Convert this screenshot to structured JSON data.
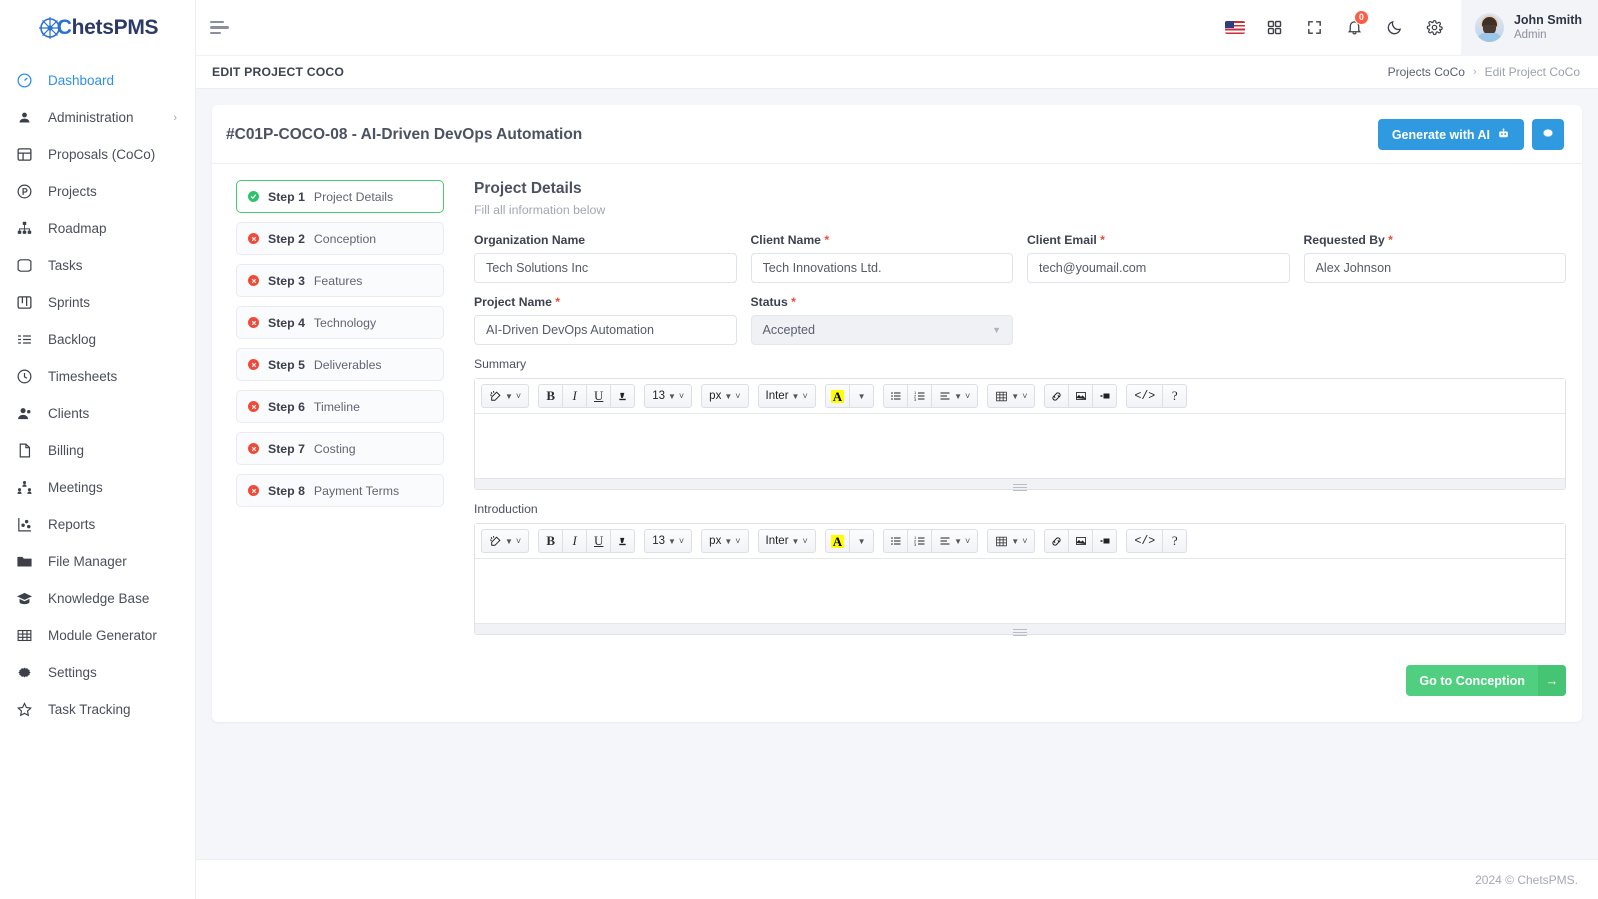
{
  "brand": {
    "name_c": "C",
    "name_rest": "hetsPMS"
  },
  "sidebar": {
    "items": [
      {
        "label": "Dashboard",
        "icon": "gauge-icon",
        "active": false,
        "chevron": false
      },
      {
        "label": "Administration",
        "icon": "user-circle-icon",
        "active": false,
        "chevron": true
      },
      {
        "label": "Proposals (CoCo)",
        "icon": "layout-icon",
        "active": true,
        "chevron": false
      },
      {
        "label": "Projects",
        "icon": "p-circle-icon",
        "active": false,
        "chevron": false
      },
      {
        "label": "Roadmap",
        "icon": "hierarchy-icon",
        "active": false,
        "chevron": false
      },
      {
        "label": "Tasks",
        "icon": "task-icon",
        "active": false,
        "chevron": false
      },
      {
        "label": "Sprints",
        "icon": "board-icon",
        "active": false,
        "chevron": false
      },
      {
        "label": "Backlog",
        "icon": "list-check-icon",
        "active": false,
        "chevron": false
      },
      {
        "label": "Timesheets",
        "icon": "clock-icon",
        "active": false,
        "chevron": false
      },
      {
        "label": "Clients",
        "icon": "user-group-icon",
        "active": false,
        "chevron": false
      },
      {
        "label": "Billing",
        "icon": "file-icon",
        "active": false,
        "chevron": false
      },
      {
        "label": "Meetings",
        "icon": "people-network-icon",
        "active": false,
        "chevron": false
      },
      {
        "label": "Reports",
        "icon": "chart-icon",
        "active": false,
        "chevron": false
      },
      {
        "label": "File Manager",
        "icon": "folder-icon",
        "active": false,
        "chevron": false
      },
      {
        "label": "Knowledge Base",
        "icon": "graduation-cap-icon",
        "active": false,
        "chevron": false
      },
      {
        "label": "Module Generator",
        "icon": "grid-table-icon",
        "active": false,
        "chevron": false
      },
      {
        "label": "Settings",
        "icon": "gear-icon",
        "active": false,
        "chevron": false
      },
      {
        "label": "Task Tracking",
        "icon": "star-icon",
        "active": false,
        "chevron": false
      }
    ]
  },
  "topbar": {
    "menu_toggle": "hamburger-icon",
    "language_flag": "us-flag-icon",
    "apps": "grid-apps-icon",
    "fullscreen": "fullscreen-icon",
    "notifications_icon": "bell-icon",
    "notifications_count": "0",
    "theme_icon": "moon-icon",
    "settings_icon": "gear-icon",
    "user_name": "John Smith",
    "user_role": "Admin"
  },
  "pagebar": {
    "title": "EDIT PROJECT COCO",
    "breadcrumb": {
      "parent": "Projects CoCo",
      "separator": "›",
      "current": "Edit Project CoCo"
    }
  },
  "card": {
    "title": "#C01P-COCO-08 - AI-Driven DevOps Automation",
    "generate_button": "Generate with AI",
    "generate_icon": "robot-icon",
    "settings_button_icon": "gear-icon"
  },
  "steps": [
    {
      "number": "Step 1",
      "label": "Project Details",
      "state": "complete",
      "active": true
    },
    {
      "number": "Step 2",
      "label": "Conception",
      "state": "error",
      "active": false
    },
    {
      "number": "Step 3",
      "label": "Features",
      "state": "error",
      "active": false
    },
    {
      "number": "Step 4",
      "label": "Technology",
      "state": "error",
      "active": false
    },
    {
      "number": "Step 5",
      "label": "Deliverables",
      "state": "error",
      "active": false
    },
    {
      "number": "Step 6",
      "label": "Timeline",
      "state": "error",
      "active": false
    },
    {
      "number": "Step 7",
      "label": "Costing",
      "state": "error",
      "active": false
    },
    {
      "number": "Step 8",
      "label": "Payment Terms",
      "state": "error",
      "active": false
    }
  ],
  "form": {
    "heading": "Project Details",
    "subheading": "Fill all information below",
    "fields": [
      {
        "label": "Organization Name",
        "required": false,
        "value": "Tech Solutions Inc",
        "type": "text"
      },
      {
        "label": "Client Name",
        "required": true,
        "value": "Tech Innovations Ltd.",
        "type": "text"
      },
      {
        "label": "Client Email",
        "required": true,
        "value": "tech@youmail.com",
        "type": "text"
      },
      {
        "label": "Requested By",
        "required": true,
        "value": "Alex Johnson",
        "type": "text"
      },
      {
        "label": "Project Name",
        "required": true,
        "value": "AI-Driven DevOps Automation",
        "type": "text"
      },
      {
        "label": "Status",
        "required": true,
        "value": "Accepted",
        "type": "select"
      }
    ],
    "editors": [
      {
        "label": "Summary",
        "value": ""
      },
      {
        "label": "Introduction",
        "value": ""
      }
    ],
    "next_button": "Go to Conception",
    "next_icon": "arrow-right-icon"
  },
  "editor_toolbar": {
    "groups": [
      {
        "buttons": [
          {
            "name": "magic-style-icon",
            "glyph": "✨",
            "caret": true,
            "chevron": true
          }
        ]
      },
      {
        "buttons": [
          {
            "name": "bold-button",
            "text": "B",
            "bold": true
          },
          {
            "name": "italic-button",
            "text": "I",
            "italic": true
          },
          {
            "name": "underline-button",
            "text": "U",
            "underline": true
          },
          {
            "name": "clear-format-button",
            "glyph": "◧"
          }
        ]
      },
      {
        "buttons": [
          {
            "name": "font-size-select",
            "text": "13",
            "caret": true,
            "chevron": true
          }
        ]
      },
      {
        "buttons": [
          {
            "name": "size-unit-select",
            "text": "px",
            "caret": true,
            "chevron": true
          }
        ]
      },
      {
        "buttons": [
          {
            "name": "font-family-select",
            "text": "Inter",
            "caret": true,
            "chevron": true
          }
        ]
      },
      {
        "buttons": [
          {
            "name": "text-highlight-button",
            "text": "A",
            "highlight": true
          },
          {
            "name": "highlight-color-caret",
            "caret": true
          }
        ]
      },
      {
        "buttons": [
          {
            "name": "unordered-list-button",
            "glyph": "☰"
          },
          {
            "name": "ordered-list-button",
            "glyph": "☰"
          },
          {
            "name": "align-button",
            "glyph": "≡",
            "caret": true,
            "chevron": true
          }
        ]
      },
      {
        "buttons": [
          {
            "name": "table-button",
            "glyph": "▦",
            "caret": true,
            "chevron": true
          }
        ]
      },
      {
        "buttons": [
          {
            "name": "link-button",
            "glyph": "⚭"
          },
          {
            "name": "image-button",
            "glyph": "Ὓc"
          },
          {
            "name": "video-button",
            "glyph": "■"
          }
        ]
      },
      {
        "buttons": [
          {
            "name": "code-view-button",
            "text": "</>"
          },
          {
            "name": "help-button",
            "text": "?"
          }
        ]
      }
    ],
    "font_size_value": "13",
    "size_unit_value": "px",
    "font_family_value": "Inter"
  },
  "footer": {
    "text": "2024 © ChetsPMS."
  },
  "colors": {
    "accent_blue": "#2f9ae0",
    "sidebar_active": "#2f8fe8",
    "success_green": "#2ec36a",
    "error_red": "#f04a3a",
    "next_green": "#4fcf7f",
    "badge_red": "#ff5b45",
    "page_bg": "#f5f6fa"
  }
}
